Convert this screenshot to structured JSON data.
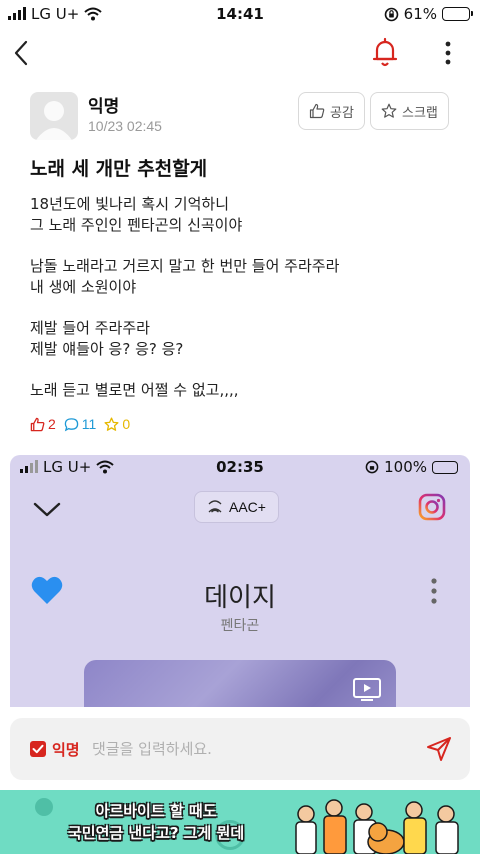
{
  "status_bar": {
    "carrier": "LG U+",
    "time": "14:41",
    "battery": "61%",
    "battery_level": 0.61
  },
  "nav": {
    "back_icon": "chevron-left-icon",
    "bell_icon": "bell-icon",
    "more_icon": "more-vertical-icon",
    "accent": "#d7261f"
  },
  "post": {
    "author": "익명",
    "date": "10/23 02:45",
    "like_button": "공감",
    "scrap_button": "스크랩",
    "title": "노래 세 개만 추천할게",
    "body_lines": [
      "18년도에 빛나리 혹시 기억하니",
      "그 노래 주인인 펜타곤의 신곡이야",
      "",
      "남돌 노래라고 거르지 말고 한 번만 들어 주라주라",
      "내 생에 소원이야",
      "",
      "제발 들어 주라주라",
      "제발 얘들아 응? 응? 응?",
      "",
      "노래 듣고 별로면 어쩔 수 없고,,,,"
    ],
    "counts": {
      "likes": "2",
      "comments": "11",
      "scraps": "0"
    },
    "colors": {
      "like": "#d7261f",
      "comment": "#1f9ad6",
      "scrap": "#e6b800"
    }
  },
  "embedded_screenshot": {
    "carrier": "LG U+",
    "time": "02:35",
    "battery": "100%",
    "battery_level": 1.0,
    "aac_label": "AAC+",
    "song_title": "데이지",
    "artist": "펜타곤",
    "background": "#d8d3ee",
    "heart_color": "#2a8ff0"
  },
  "comment_composer": {
    "anon_label": "익명",
    "anon_checked": true,
    "placeholder": "댓글을 입력하세요.",
    "send_icon": "send-icon"
  },
  "ad_banner": {
    "line1": "아르바이트 할 때도",
    "line2": "국민연금 낸다고? 그게 뭔데",
    "background": "#6fdcc3"
  }
}
